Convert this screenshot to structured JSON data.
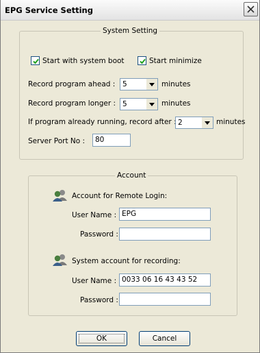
{
  "window": {
    "title": "EPG Service Setting"
  },
  "system_setting": {
    "legend": "System Setting",
    "start_with_system_boot": {
      "label": "Start with system boot",
      "checked": true
    },
    "start_minimize": {
      "label": "Start minimize",
      "checked": true
    },
    "record_ahead": {
      "label": "Record program ahead :",
      "value": "5",
      "unit": "minutes"
    },
    "record_longer": {
      "label": "Record program longer :",
      "value": "5",
      "unit": "minutes"
    },
    "running_after": {
      "label": "If program already running, record after :",
      "value": "2",
      "unit": "minutes"
    },
    "server_port": {
      "label": "Server Port No :",
      "value": "80"
    }
  },
  "account": {
    "legend": "Account",
    "remote_login": {
      "heading": "Account for Remote Login:",
      "user_name_label": "User Name :",
      "user_name_value": "EPG",
      "password_label": "Password :",
      "password_value": ""
    },
    "system_recording": {
      "heading": "System account for recording:",
      "user_name_label": "User Name :",
      "user_name_value": "0033  06 16 43 43 52",
      "password_label": "Password :",
      "password_value": ""
    },
    "icon": "users-icon"
  },
  "buttons": {
    "ok": "OK",
    "cancel": "Cancel"
  }
}
